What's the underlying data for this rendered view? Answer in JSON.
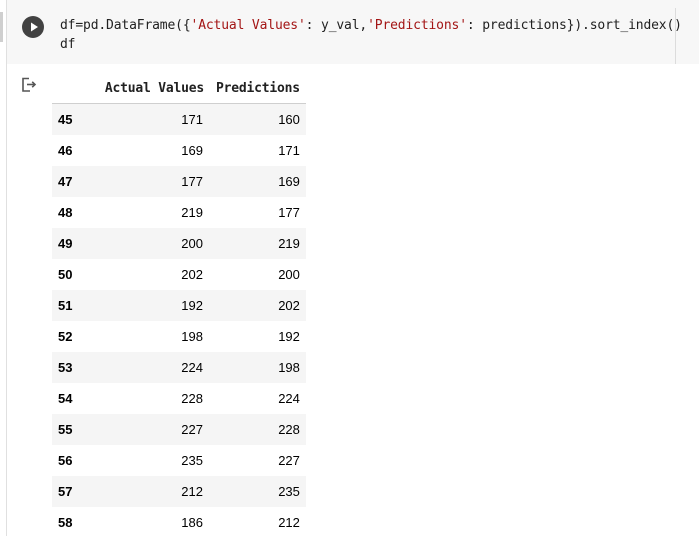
{
  "code_cell": {
    "line1": {
      "prefix": "df=pd.DataFrame({",
      "key1": "'Actual Values'",
      "mid1": ": y_val,",
      "key2": "'Predictions'",
      "suffix": ": predictions}).sort_index()"
    },
    "line2": "df",
    "run_icon": "play-icon",
    "output_icon": "output-redirect-icon"
  },
  "dataframe": {
    "columns": [
      "Actual Values",
      "Predictions"
    ],
    "rows": [
      {
        "index": "45",
        "actual": "171",
        "pred": "160"
      },
      {
        "index": "46",
        "actual": "169",
        "pred": "171"
      },
      {
        "index": "47",
        "actual": "177",
        "pred": "169"
      },
      {
        "index": "48",
        "actual": "219",
        "pred": "177"
      },
      {
        "index": "49",
        "actual": "200",
        "pred": "219"
      },
      {
        "index": "50",
        "actual": "202",
        "pred": "200"
      },
      {
        "index": "51",
        "actual": "192",
        "pred": "202"
      },
      {
        "index": "52",
        "actual": "198",
        "pred": "192"
      },
      {
        "index": "53",
        "actual": "224",
        "pred": "198"
      },
      {
        "index": "54",
        "actual": "228",
        "pred": "224"
      },
      {
        "index": "55",
        "actual": "227",
        "pred": "228"
      },
      {
        "index": "56",
        "actual": "235",
        "pred": "227"
      },
      {
        "index": "57",
        "actual": "212",
        "pred": "235"
      },
      {
        "index": "58",
        "actual": "186",
        "pred": "212"
      }
    ]
  },
  "colors": {
    "cell_bg": "#f7f7f7",
    "string_literal": "#a31515",
    "row_stripe": "#f5f5f5",
    "run_button": "#424242"
  }
}
